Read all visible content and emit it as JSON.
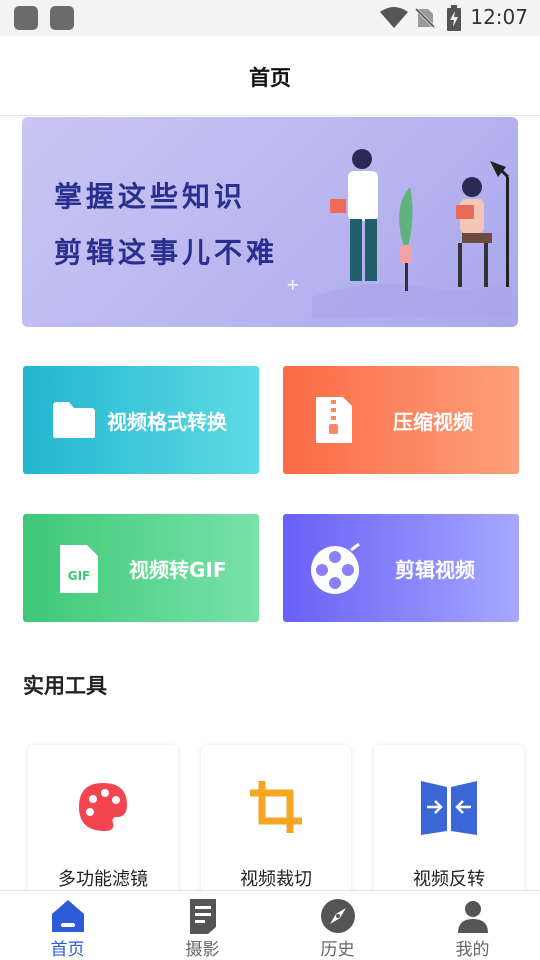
{
  "status_bar": {
    "time": "12:07"
  },
  "header": {
    "title": "首页"
  },
  "banner": {
    "line1": "掌握这些知识",
    "line2": "剪辑这事儿不难"
  },
  "features": [
    {
      "label": "视频格式转换",
      "icon": "folder-icon",
      "color_start": "#23b6cf",
      "color_end": "#5ddbe6"
    },
    {
      "label": "压缩视频",
      "icon": "zip-file-icon",
      "color_start": "#fb6a45",
      "color_end": "#fda07a"
    },
    {
      "label": "视频转GIF",
      "icon": "gif-file-icon",
      "icon_text": "GIF",
      "color_start": "#3ec878",
      "color_end": "#79e2a8"
    },
    {
      "label": "剪辑视频",
      "icon": "film-reel-icon",
      "color_start": "#6a5ff7",
      "color_end": "#a6a8ff"
    }
  ],
  "tools_section": {
    "title": "实用工具"
  },
  "tools": [
    {
      "label": "多功能滤镜",
      "icon": "palette-icon",
      "color": "#f2454f"
    },
    {
      "label": "视频裁切",
      "icon": "crop-icon",
      "color": "#f5a623"
    },
    {
      "label": "视频反转",
      "icon": "flip-icon",
      "color": "#3b66d6"
    }
  ],
  "nav": {
    "active_color": "#2c5bd7",
    "inactive_color": "#666666",
    "items": [
      {
        "label": "首页",
        "icon": "home-icon"
      },
      {
        "label": "摄影",
        "icon": "document-icon"
      },
      {
        "label": "历史",
        "icon": "compass-icon"
      },
      {
        "label": "我的",
        "icon": "person-icon"
      }
    ]
  }
}
